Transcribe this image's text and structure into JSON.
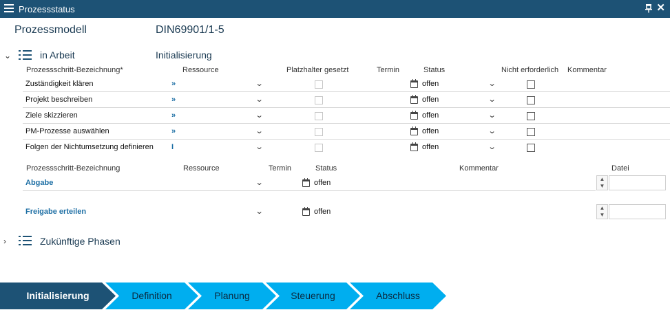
{
  "window": {
    "title": "Prozessstatus"
  },
  "model": {
    "label": "Prozessmodell",
    "value": "DIN69901/1-5"
  },
  "current_section": {
    "title": "in Arbeit",
    "phase": "Initialisierung",
    "headers": {
      "name": "Prozessschritt-Bezeichnung*",
      "resource": "Ressource",
      "placeholder": "Platzhalter gesetzt",
      "date": "Termin",
      "status": "Status",
      "not_required": "Nicht erforderlich",
      "comment": "Kommentar"
    },
    "rows": [
      {
        "name": "Zuständigkeit klären",
        "marker": "»",
        "status": "offen"
      },
      {
        "name": "Projekt beschreiben",
        "marker": "»",
        "status": "offen"
      },
      {
        "name": "Ziele skizzieren",
        "marker": "»",
        "status": "offen"
      },
      {
        "name": "PM-Prozesse auswählen",
        "marker": "»",
        "status": "offen"
      },
      {
        "name": "Folgen der Nichtumsetzung definieren",
        "marker": "I",
        "status": "offen"
      }
    ]
  },
  "milestones": {
    "headers": {
      "name": "Prozessschritt-Bezeichnung",
      "resource": "Ressource",
      "date": "Termin",
      "status": "Status",
      "comment": "Kommentar",
      "file": "Datei"
    },
    "rows": [
      {
        "name": "Abgabe",
        "status": "offen"
      },
      {
        "name": "Freigabe erteilen",
        "status": "offen"
      }
    ]
  },
  "future_section": {
    "title": "Zukünftige Phasen"
  },
  "phases": {
    "items": [
      "Initialisierung",
      "Definition",
      "Planung",
      "Steuerung",
      "Abschluss"
    ],
    "active": "Initialisierung"
  },
  "colors": {
    "titlebar": "#1d5275",
    "step_active": "#1d5275",
    "step": "#00aeef",
    "link": "#1c6ea4"
  }
}
